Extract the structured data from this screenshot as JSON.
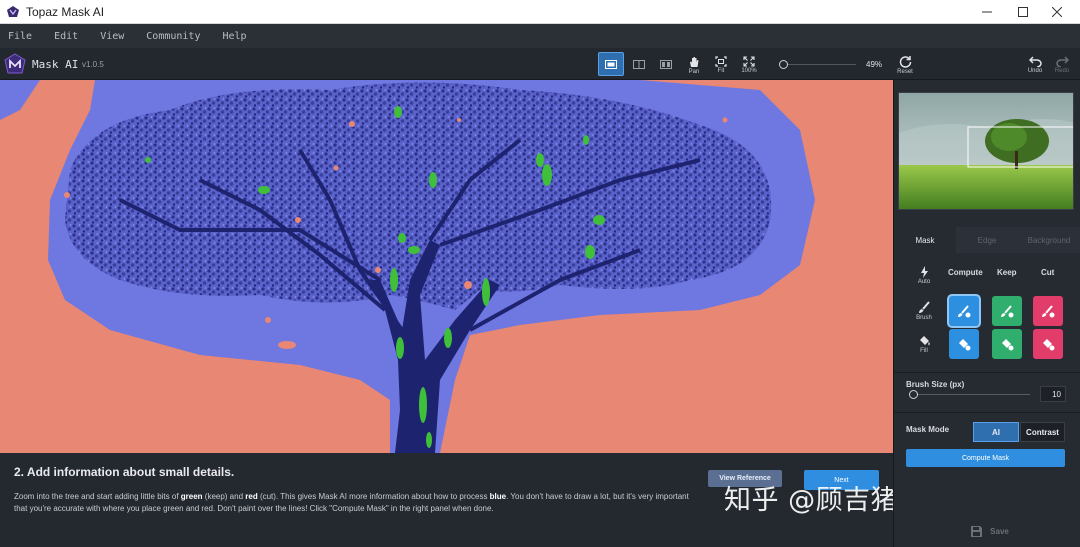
{
  "window": {
    "title": "Topaz Mask AI",
    "controls": [
      "minimize",
      "maximize",
      "close"
    ]
  },
  "menu": [
    "File",
    "Edit",
    "View",
    "Community",
    "Help"
  ],
  "toolbar": {
    "app_name": "Mask AI",
    "version": "v1.0.5",
    "pan_label": "Pan",
    "fit_label": "Fit",
    "zoom100_label": "100%",
    "zoom_value": "49%",
    "reset_label": "Reset",
    "undo_label": "Undo",
    "redo_label": "Redo"
  },
  "instructions": {
    "title": "2. Add information about small details.",
    "text_before_green": "Zoom into the tree and start adding little bits of ",
    "green_word": "green",
    "text_after_green": " (keep) and ",
    "red_word": "red",
    "text_after_red": " (cut). This gives Mask AI more information about how to process ",
    "blue_word": "blue",
    "text_after_blue": ". You don't have to draw a lot, but it's very important that you're accurate with where you place green and red. Don't paint over the lines! Click \"Compute Mask\" in the right panel when done.",
    "view_reference_label": "View Reference",
    "next_label": "Next"
  },
  "watermark": "知乎 @顾吉猪-Keyhong",
  "panel": {
    "tabs": [
      "Mask",
      "Edge",
      "Background"
    ],
    "active_tab": "Mask",
    "columns": [
      "Compute",
      "Keep",
      "Cut"
    ],
    "auto_label": "Auto",
    "brush_label": "Brush",
    "fill_label": "Fill",
    "brush_size_title": "Brush Size (px)",
    "brush_size_value": "10",
    "mask_mode_title": "Mask Mode",
    "mode_ai": "AI",
    "mode_contrast": "Contrast",
    "compute_mask_label": "Compute Mask",
    "save_label": "Save"
  },
  "colors": {
    "compute": "#2d8fe0",
    "keep": "#2fae6e",
    "cut": "#e23d6a",
    "accent": "#2f8ee0",
    "mask_blue": "#6f78e0",
    "mask_red": "#e88773",
    "keep_green": "#3fbf3a"
  },
  "icons": {
    "window": "app-icon",
    "logo": "mask-ai-logo",
    "pan": "hand-icon",
    "fit": "fit-icon",
    "zoom100": "expand-icon",
    "reset": "reset-icon",
    "undo": "undo-icon",
    "redo": "redo-icon",
    "auto": "lightning-icon",
    "brush": "brush-icon",
    "fill": "bucket-icon",
    "save": "floppy-icon"
  }
}
